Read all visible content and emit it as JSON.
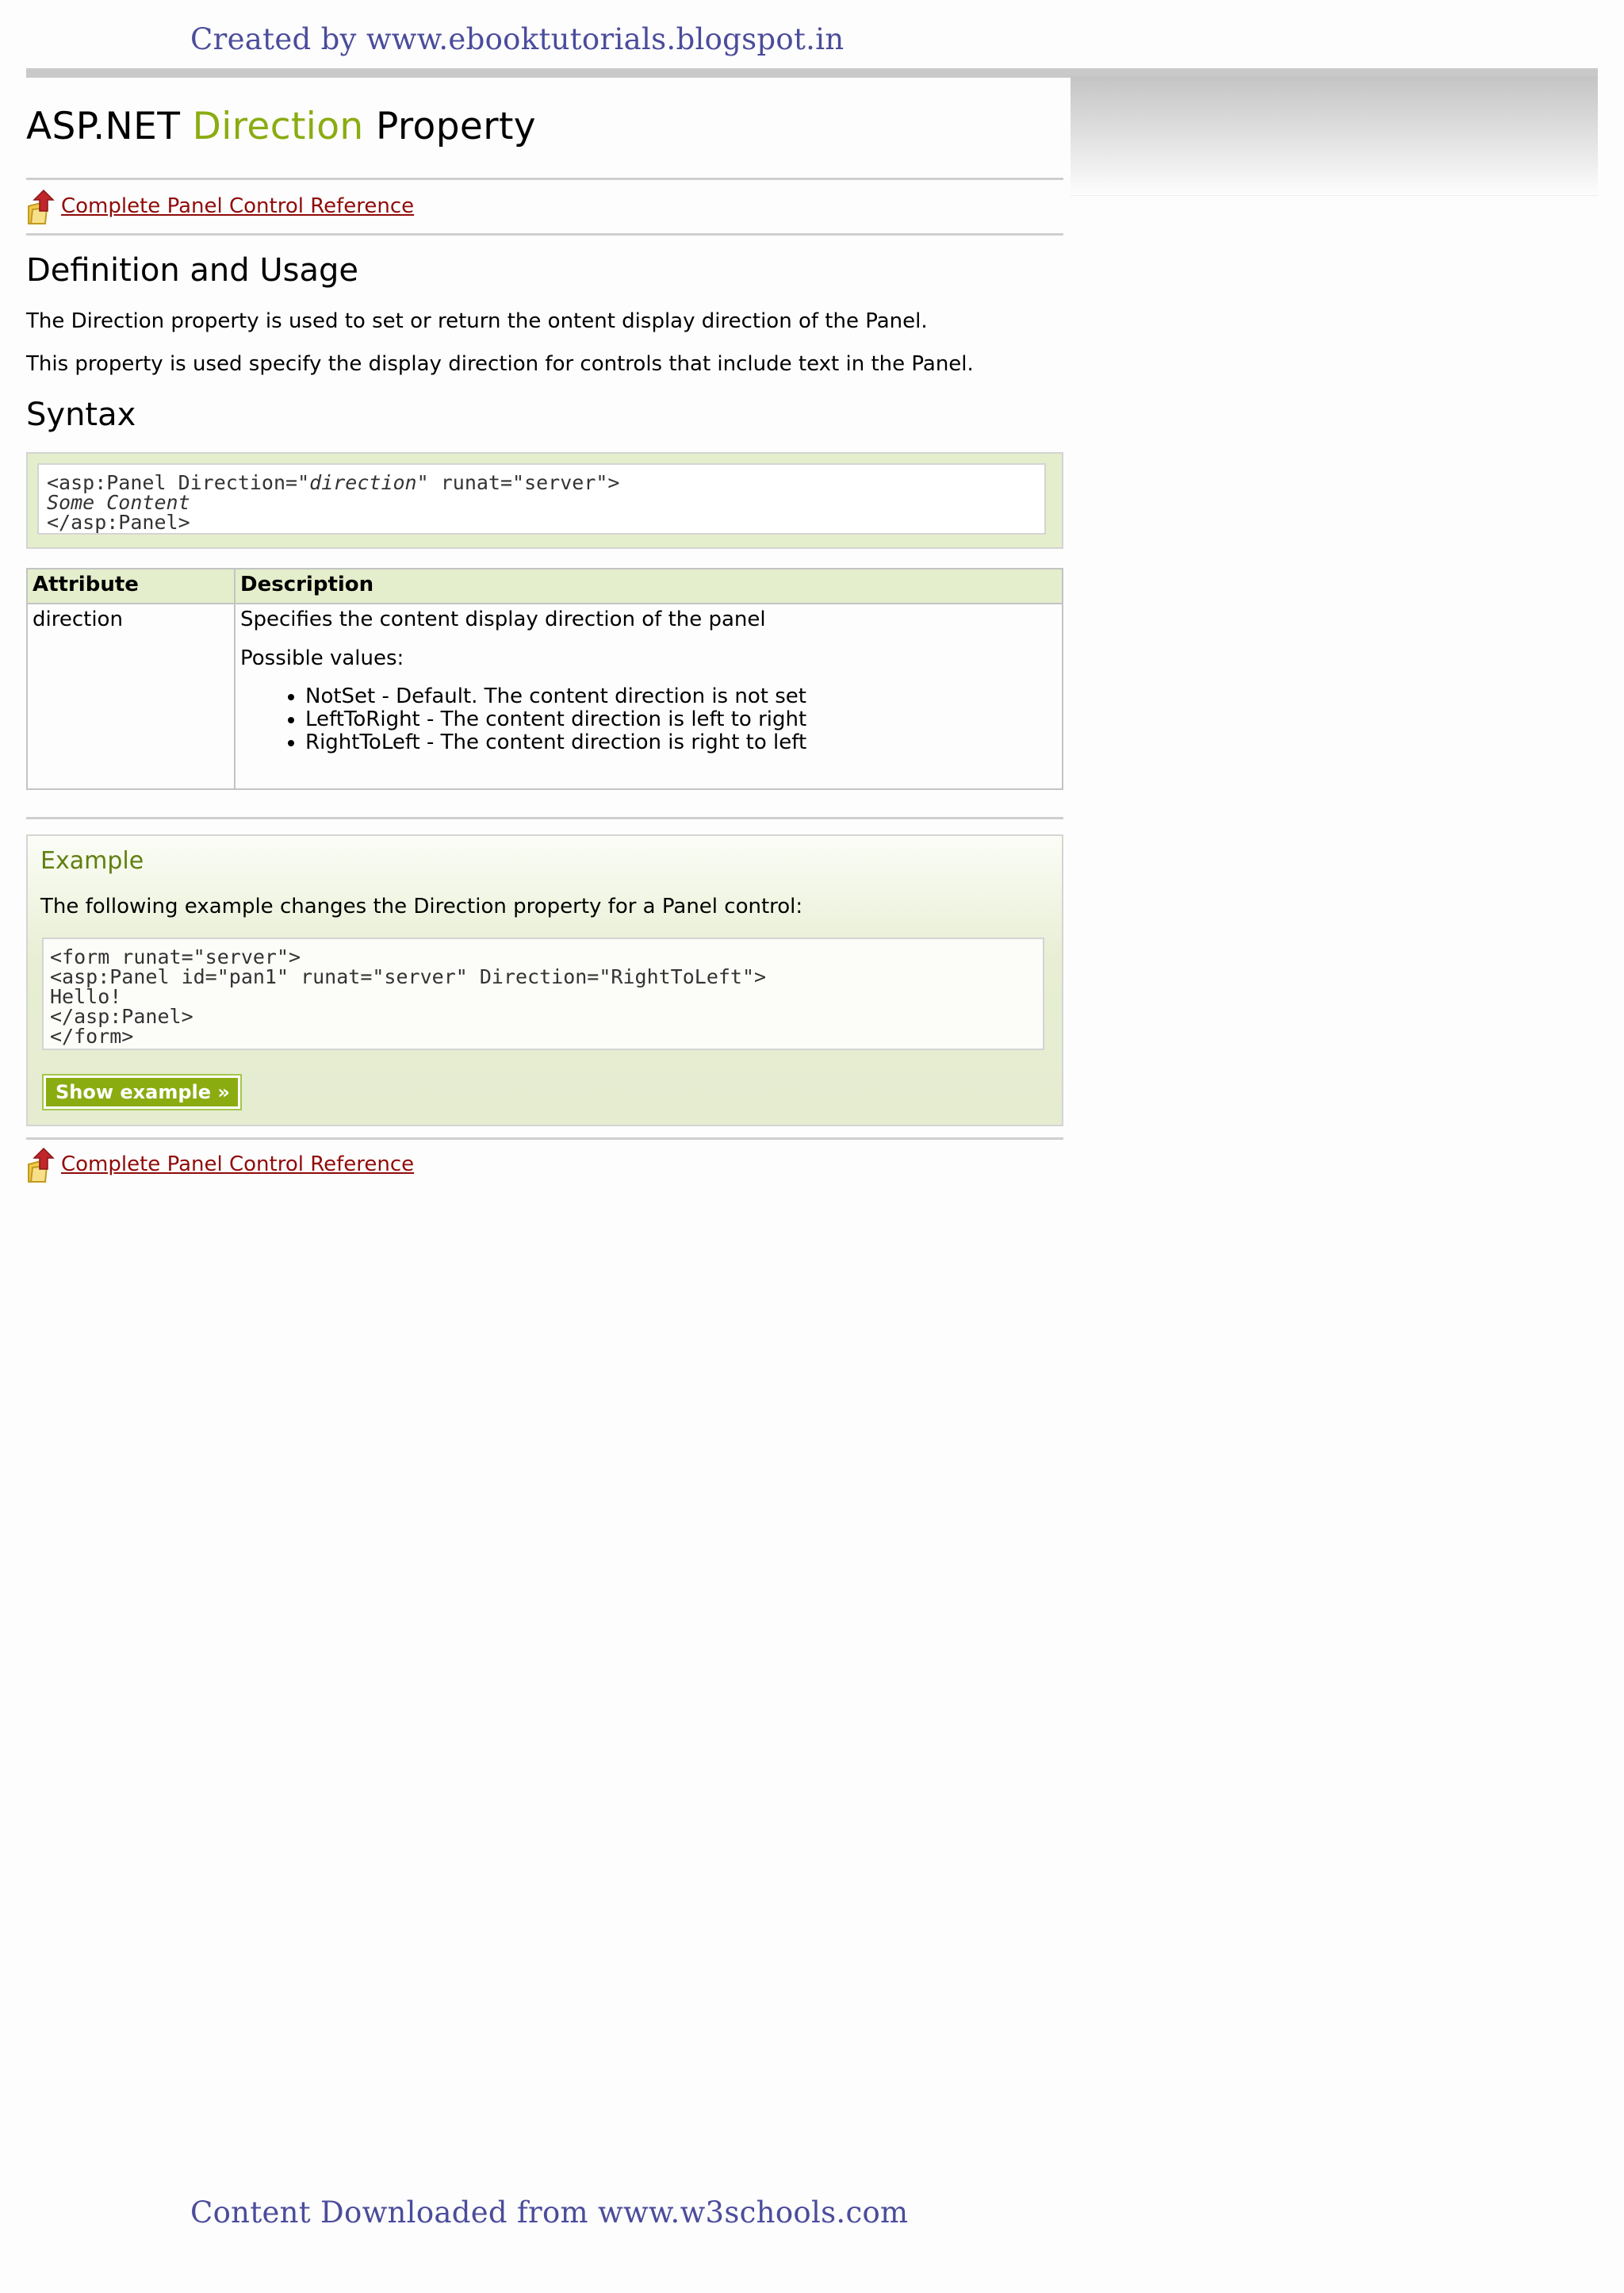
{
  "watermark": {
    "top": "Created by www.ebooktutorials.blogspot.in",
    "bottom": "Content Downloaded from www.w3schools.com"
  },
  "title": {
    "part1": "ASP.NET",
    "accent": "Direction",
    "part2": "Property"
  },
  "reference_link": "Complete Panel Control Reference",
  "definition": {
    "heading": "Definition and Usage",
    "para1": "The Direction property is used to set or return the  ontent display direction of the Panel.",
    "para2": "This property is used specify the display direction for controls that include text in the Panel."
  },
  "syntax": {
    "heading": "Syntax",
    "line1_a": "<asp:Panel Direction=\"",
    "line1_italic": "direction",
    "line1_b": "\" runat=\"server\">",
    "line2": "Some Content",
    "line3": "</asp:Panel>"
  },
  "table": {
    "headers": [
      "Attribute",
      "Description"
    ],
    "row": {
      "attribute": "direction",
      "desc": "Specifies the content display direction of the panel",
      "possible": "Possible values:",
      "values": [
        "NotSet - Default. The content direction is not set",
        "LeftToRight - The content direction is left to right",
        "RightToLeft - The content direction is right to left"
      ]
    }
  },
  "example": {
    "heading": "Example",
    "text": "The following example changes the Direction property for a Panel control:",
    "code": [
      "<form runat=\"server\">",
      "<asp:Panel id=\"pan1\" runat=\"server\" Direction=\"RightToLeft\">",
      "Hello!",
      "</asp:Panel>",
      "</form>"
    ],
    "button": "Show example »"
  },
  "colors": {
    "accent": "#8aac11",
    "link": "#900b09",
    "watermark": "#4b4c9b",
    "example_heading": "#617f10"
  }
}
